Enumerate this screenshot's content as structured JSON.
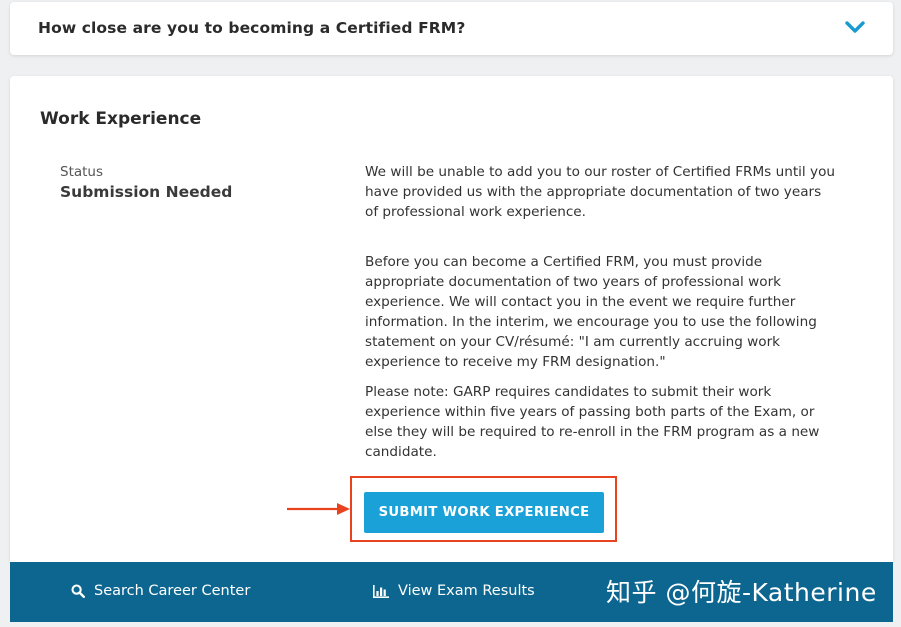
{
  "accordion": {
    "title": "How close are you to becoming a Certified FRM?",
    "toggle_icon": "chevron-down-icon"
  },
  "work_experience": {
    "title": "Work Experience",
    "status_label": "Status",
    "status_value": "Submission Needed",
    "paragraphs": [
      "We will be unable to add you to our roster of Certified FRMs until you have provided us with the appropriate documentation of two years of professional work experience.",
      "Before you can become a Certified FRM, you must provide appropriate documentation of two years of professional work experience. We will contact you in the event we require further information. In the interim, we encourage you to use the following statement on your CV/résumé: \"I am currently accruing work experience to receive my FRM designation.\"",
      "Please note: GARP requires candidates to submit their work experience within five years of passing both parts of the Exam, or else they will be required to re-enroll in the FRM program as a new candidate."
    ],
    "submit_label": "SUBMIT WORK EXPERIENCE"
  },
  "footer": {
    "links": [
      {
        "label": "Search Career Center",
        "icon": "search-icon"
      },
      {
        "label": "View Exam Results",
        "icon": "bar-chart-icon"
      }
    ],
    "watermark": "知乎 @何旋-Katherine"
  },
  "colors": {
    "accent": "#1aa2d8",
    "footer": "#0d6690",
    "highlight": "#e8431e",
    "chevron": "#1a9bd0"
  }
}
